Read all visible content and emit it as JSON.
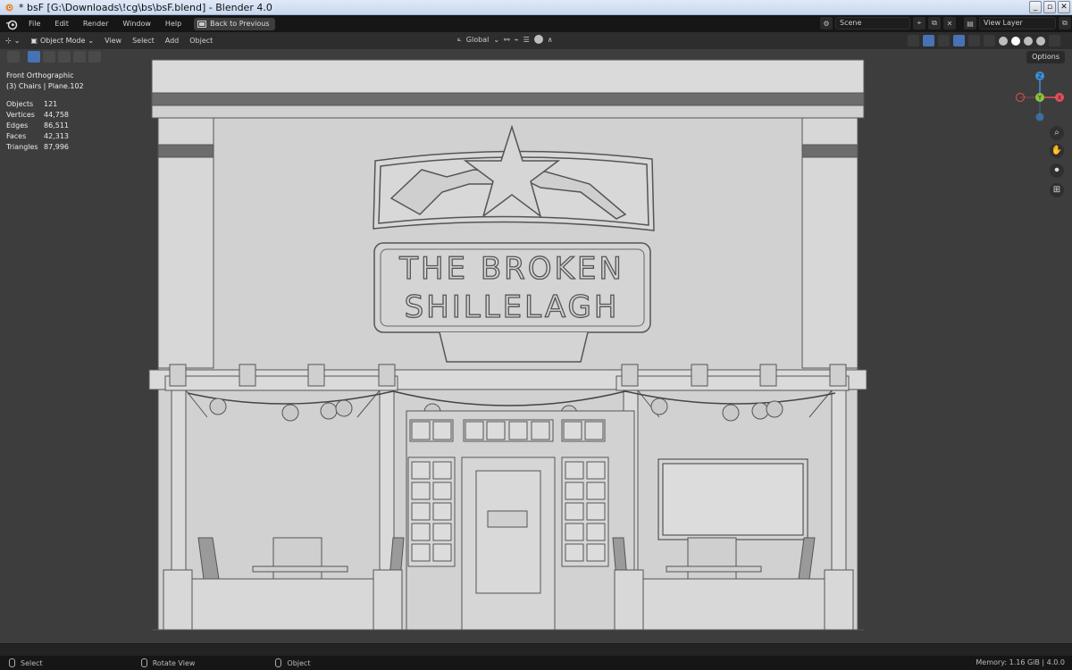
{
  "window": {
    "title": "* bsF [G:\\Downloads\\!cg\\bs\\bsF.blend] - Blender 4.0",
    "buttons": [
      "_",
      "▫",
      "✕"
    ]
  },
  "menubar": {
    "items": [
      "File",
      "Edit",
      "Render",
      "Window",
      "Help"
    ],
    "back_button": "Back to Previous",
    "scene_label": "Scene",
    "view_layer_label": "View Layer"
  },
  "viewport_header": {
    "mode": "Object Mode",
    "menus": [
      "View",
      "Select",
      "Add",
      "Object"
    ],
    "transform_orientation": "Global",
    "options_label": "Options"
  },
  "overlay": {
    "view_name": "Front Orthographic",
    "collection_object": "(3) Chairs | Plane.102",
    "stats": [
      {
        "label": "Objects",
        "value": "121"
      },
      {
        "label": "Vertices",
        "value": "44,758"
      },
      {
        "label": "Edges",
        "value": "86,511"
      },
      {
        "label": "Faces",
        "value": "42,313"
      },
      {
        "label": "Triangles",
        "value": "87,996"
      }
    ]
  },
  "scene": {
    "sign_line1": "THE BROKEN",
    "sign_line2": "SHILLELAGH"
  },
  "gizmo": {
    "z": "Z",
    "y": "Y",
    "x": "X"
  },
  "statusbar": {
    "select": "Select",
    "rotate": "Rotate View",
    "object": "Object",
    "memory": "Memory: 1.16 GiB | 4.0.0"
  },
  "colors": {
    "accent_blue": "#4772b3",
    "axis_x": "#e84e5c",
    "axis_y": "#8bc53f",
    "axis_z": "#3d8fd9"
  }
}
